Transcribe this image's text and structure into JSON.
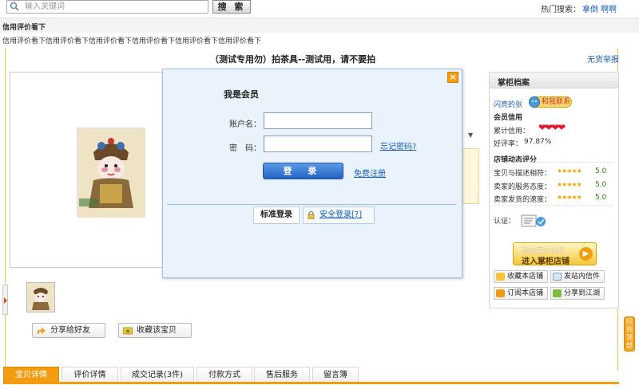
{
  "topbar": {
    "search_placeholder": "输入关键词",
    "search_button": "搜 索",
    "hot_label": "热门搜索：",
    "hot_keywords": [
      "拿倒",
      "啊啊"
    ]
  },
  "store": {
    "title": "信用评价看下",
    "subtitle": "信用评价看下信用评价看下信用评价看下信用评价看下信用评价看下信用评价看下"
  },
  "item": {
    "title": "（测试专用勿）拍茶具--测试用，请不要拍",
    "report_link": "无货举报"
  },
  "actions": {
    "share": "分享给好友",
    "favorite": "收藏该宝贝"
  },
  "tabs": [
    "宝贝详情",
    "评价详情",
    "成交记录(3件)",
    "付款方式",
    "售后服务",
    "留言簿"
  ],
  "seller_panel": {
    "title": "掌柜档案",
    "seller_name": "闪亮的张",
    "contact": "和我联系",
    "credit_title": "会员信用",
    "cumulative_credit_label": "累计信用：",
    "positive_rate_label": "好评率：",
    "positive_rate": "97.87%",
    "dynamic_title": "店铺动态评分",
    "ratings": [
      {
        "label": "宝贝与描述相符：",
        "score": "5.0",
        "stars": "★★★★★"
      },
      {
        "label": "卖家的服务态度：",
        "score": "5.0",
        "stars": "★★★★★"
      },
      {
        "label": "卖家发货的速度：",
        "score": "5.0",
        "stars": "★★★★★"
      }
    ],
    "certification_label": "认证：",
    "enter_shop_line1": "挑选更多商品",
    "enter_shop_line2": "进入掌柜店铺",
    "buttons": {
      "favorite_shop": "收藏本店铺",
      "send_message": "发站内信件",
      "subscribe_shop": "订阅本店铺",
      "share_to": "分享到江湖"
    }
  },
  "back_to_top": "回到顶部",
  "login_modal": {
    "heading": "我是会员",
    "account_label": "账户名：",
    "password_label": "密　码：",
    "forgot_password": "忘记密码?",
    "login_button": "登 录",
    "register": "免费注册",
    "tab_standard": "标准登录",
    "tab_secure": "安全登录[?]"
  },
  "colors": {
    "accent_orange": "#f39c11",
    "link_blue": "#1a5fb4",
    "modal_bg": "#eaf3fc"
  }
}
